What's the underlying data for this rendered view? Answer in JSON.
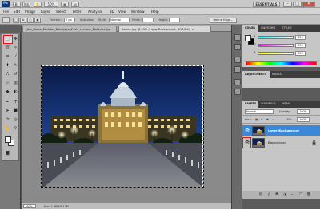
{
  "app": {
    "logo": "Ps",
    "zoom_dropdown": "50%",
    "workspace_label": "ESSENTIALS",
    "window_controls": [
      "–",
      "□",
      "✕"
    ]
  },
  "menu": [
    "File",
    "Edit",
    "Image",
    "Layer",
    "Select",
    "Filter",
    "Analysis",
    "3D",
    "View",
    "Window",
    "Help"
  ],
  "options_bar": {
    "feather_label": "Feather:",
    "feather_value": "0 px",
    "antialias_label": "Anti-alias",
    "style_label": "Style:",
    "style_value": "Normal",
    "width_label": "Width:",
    "height_label": "Height:",
    "refine_edge_label": "Refine Edge..."
  },
  "tabs": [
    {
      "label": "_the_Prime_Minister_Putrajaya_Kuala_Lumpur_Malaysia.jpg",
      "active": false
    },
    {
      "label": "Before.jpg @ 50% (Layer Background, RGB/8#)",
      "active": true
    }
  ],
  "status": {
    "zoom": "50%",
    "doc_info": "Doc: 1.48M/5.17M"
  },
  "color_panel": {
    "tabs": [
      "COLOR",
      "SWATCHES",
      "STYLES"
    ],
    "sliders": [
      {
        "label": "R",
        "value": "255",
        "color": "#e0283a"
      },
      {
        "label": "G",
        "value": "255",
        "color": "#29b030"
      },
      {
        "label": "B",
        "value": "255",
        "color": "#2c52d8"
      }
    ]
  },
  "adjustments_panel": {
    "tabs": [
      "ADJUSTMENTS",
      "MASKS"
    ]
  },
  "layers_panel": {
    "tabs": [
      "LAYERS",
      "CHANNELS",
      "PATHS"
    ],
    "blend_mode": "Normal",
    "opacity_label": "Opacity:",
    "opacity_value": "100%",
    "lock_label": "Lock:",
    "fill_label": "Fill:",
    "fill_value": "100%",
    "layers": [
      {
        "name": "Layer Background",
        "selected": true,
        "visible": true
      },
      {
        "name": "Background",
        "selected": false,
        "visible": true
      }
    ],
    "footer_icons": [
      "link-icon",
      "fx-icon",
      "mask-icon",
      "adjustment-icon",
      "folder-icon",
      "new-layer-icon",
      "trash-icon"
    ]
  },
  "colors": {
    "accent_highlight": "#e0181e",
    "selection_blue": "#3b87d8"
  }
}
